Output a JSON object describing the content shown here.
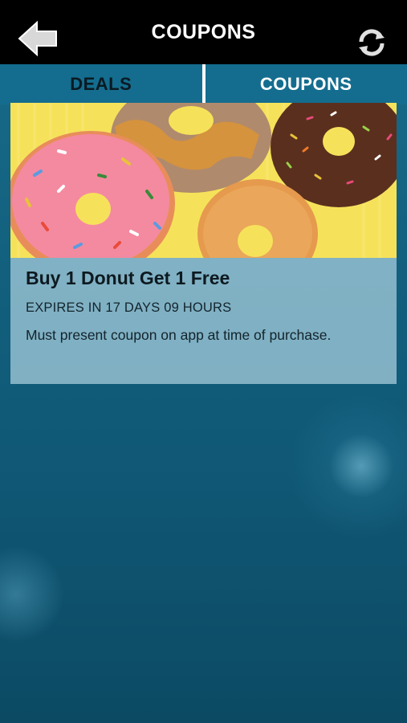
{
  "header": {
    "title": "COUPONS",
    "back_icon": "back-arrow-icon",
    "refresh_icon": "refresh-icon"
  },
  "tabs": [
    {
      "label": "DEALS",
      "active": false
    },
    {
      "label": "COUPONS",
      "active": true
    }
  ],
  "coupon": {
    "title": "Buy 1 Donut Get 1 Free",
    "expiry": "EXPIRES IN 17 DAYS 09 HOURS",
    "description": "Must present coupon on app at time of purchase.",
    "image": "donuts-image"
  },
  "colors": {
    "topbar": "#000000",
    "background": "#12617f",
    "image_background": "#f6e25a",
    "pink_frosting": "#f48aa0",
    "glazed": "#e59a4e"
  }
}
